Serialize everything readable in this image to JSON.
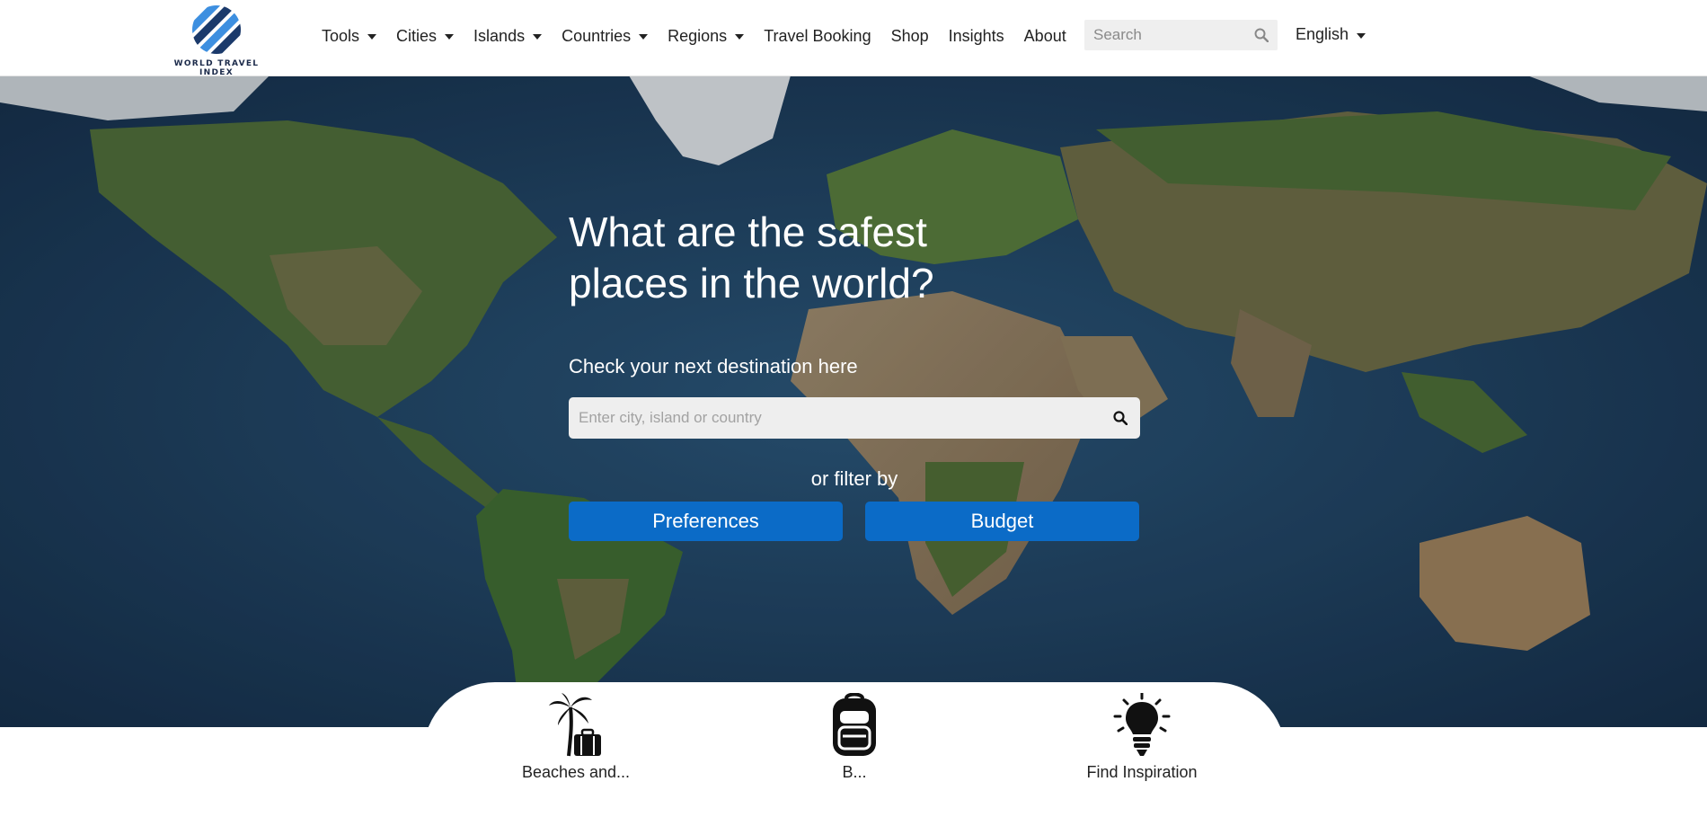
{
  "header": {
    "logo_text": "WORLD TRAVEL INDEX",
    "nav": [
      {
        "label": "Tools",
        "dropdown": true
      },
      {
        "label": "Cities",
        "dropdown": true
      },
      {
        "label": "Islands",
        "dropdown": true
      },
      {
        "label": "Countries",
        "dropdown": true
      },
      {
        "label": "Regions",
        "dropdown": true
      },
      {
        "label": "Travel Booking",
        "dropdown": false
      },
      {
        "label": "Shop",
        "dropdown": false
      },
      {
        "label": "Insights",
        "dropdown": false
      },
      {
        "label": "About",
        "dropdown": false
      }
    ],
    "search_placeholder": "Search",
    "language": "English"
  },
  "hero": {
    "title": "What are the safest places in the world?",
    "subtitle": "Check your next destination here",
    "search_placeholder": "Enter city, island or country",
    "filter_label": "or filter by",
    "buttons": {
      "preferences": "Preferences",
      "budget": "Budget"
    }
  },
  "categories": [
    {
      "icon": "palm-suitcase-icon",
      "label": "Beaches and..."
    },
    {
      "icon": "backpack-icon",
      "label": "B..."
    },
    {
      "icon": "lightbulb-icon",
      "label": "Find Inspiration"
    }
  ],
  "colors": {
    "accent": "#0b6bc7",
    "ocean": "#1b3a5a",
    "land": "#4a6b3a",
    "header_bg": "#ffffff"
  }
}
